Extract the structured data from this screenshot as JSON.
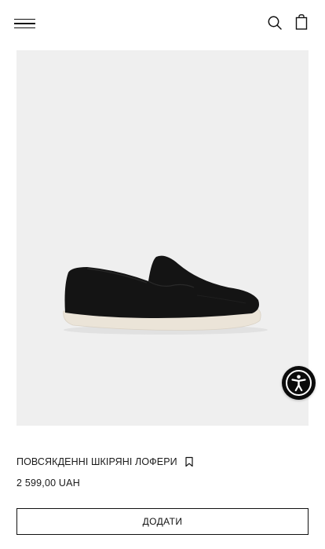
{
  "header": {
    "menu_icon": "hamburger-menu-icon",
    "search_icon": "search-icon",
    "bag_icon": "shopping-bag-icon"
  },
  "product": {
    "title": "ПОВСЯКДЕННІ ШКІРЯНІ ЛОФЕРИ",
    "price": "2 599,00 UAH",
    "bookmark_icon": "bookmark-icon",
    "image_background": "#efefef",
    "shoe_color": "#141414",
    "sole_color": "#ece6dc"
  },
  "actions": {
    "add_label": "ДОДАТИ"
  },
  "accessibility": {
    "icon": "accessibility-person-icon",
    "color": "#0b0b0b"
  }
}
